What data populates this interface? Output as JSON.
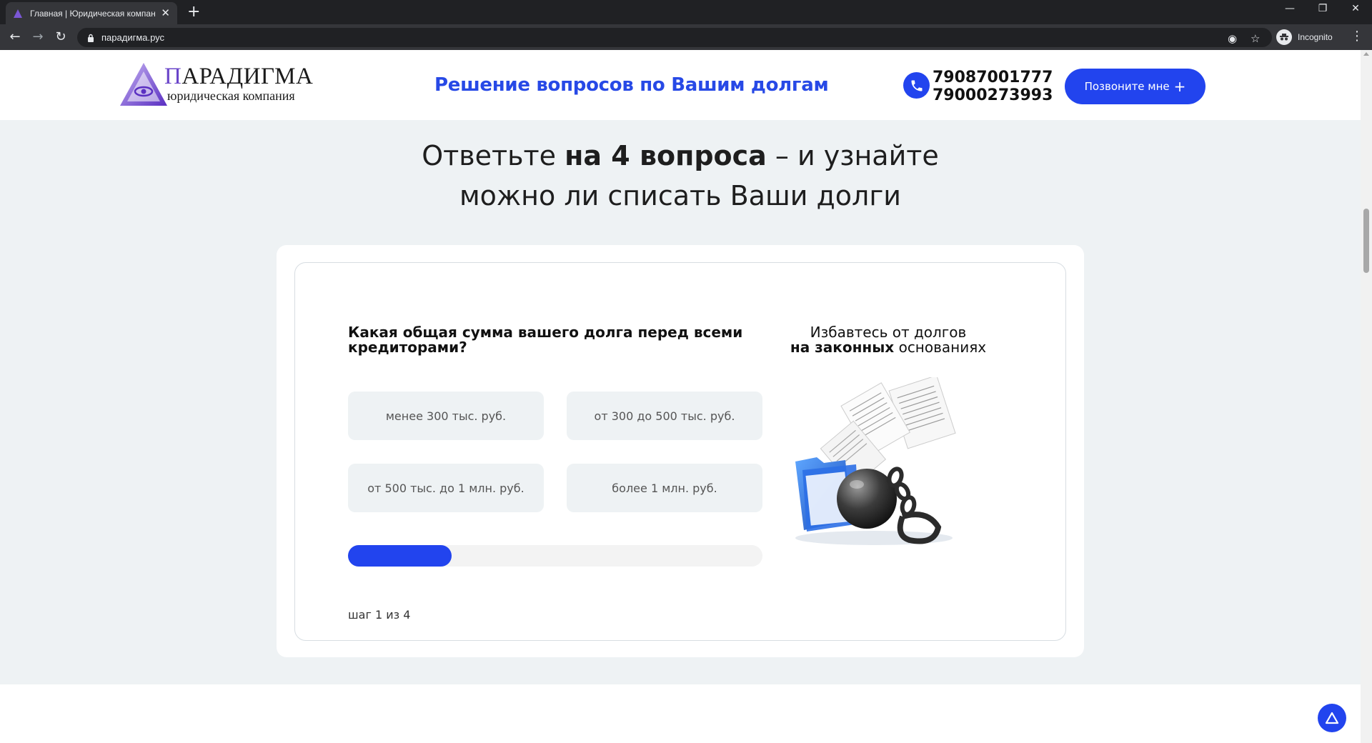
{
  "browser": {
    "tab_title": "Главная | Юридическая компания Парадигма",
    "new_tab": "+",
    "close": "✕",
    "url": "парадигма.рус",
    "incognito_label": "Incognito"
  },
  "header": {
    "logo_first": "П",
    "logo_rest": "АРАДИГМА",
    "logo_sub": "юридическая компания",
    "tagline": "Решение вопросов по Вашим долгам",
    "phones": [
      "79087001777",
      "79000273993"
    ],
    "call_button": "Позвоните мне"
  },
  "headline": {
    "part1": "Ответьте ",
    "bold": "на 4 вопроса",
    "part2": " – и узнайте",
    "line2": "можно ли списать Ваши долги"
  },
  "quiz": {
    "question": "Какая общая сумма вашего долга перед всеми кредиторами?",
    "options": [
      "менее 300 тыс. руб.",
      "от 300 до 500 тыс. руб.",
      "от 500 тыс. до 1 млн. руб.",
      "более 1 млн. руб."
    ],
    "progress_percent": 25,
    "step_label": "шаг 1 из 4"
  },
  "promo": {
    "line1": "Избавтесь от долгов",
    "bold": "на законных",
    "rest": " основаниях"
  },
  "colors": {
    "accent": "#2244ee",
    "tagline": "#2749e6",
    "logo_purple": "#6a45c9"
  }
}
